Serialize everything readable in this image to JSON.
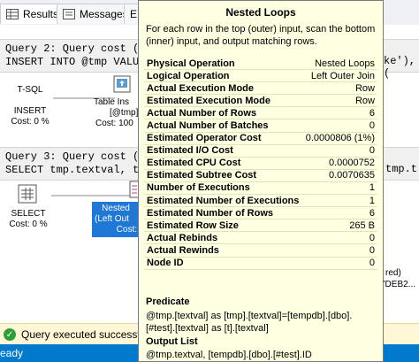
{
  "tabs": [
    {
      "label": "Results"
    },
    {
      "label": "Messages"
    },
    {
      "label": "E"
    }
  ],
  "query2": {
    "header": "Query 2: Query cost (",
    "sql": "INSERT INTO @tmp VALU",
    "sql_right": "ke'), ("
  },
  "query3": {
    "header": "Query 3: Query cost (",
    "sql": "SELECT tmp.textval, t",
    "sql_right": "tmp.t"
  },
  "nodes": {
    "tsql_label": "T-SQL",
    "insert_label": "INSERT",
    "insert_cost": "Cost: 0 %",
    "table_insert_label": "Table Ins",
    "table_insert_sub": "[@tmp]",
    "table_insert_cost": "Cost: 100",
    "select_label": "SELECT",
    "select_cost": "Cost: 0 %",
    "nested_label": "Nested",
    "nested_sub": "(Left Out",
    "nested_cost": "Cost:",
    "right_text1": "red)",
    "right_text2": "7DEB2..."
  },
  "tooltip": {
    "title": "Nested Loops",
    "description": "For each row in the top (outer) input, scan the bottom (inner) input, and output matching rows.",
    "properties": [
      {
        "key": "Physical Operation",
        "value": "Nested Loops"
      },
      {
        "key": "Logical Operation",
        "value": "Left Outer Join"
      },
      {
        "key": "Actual Execution Mode",
        "value": "Row"
      },
      {
        "key": "Estimated Execution Mode",
        "value": "Row"
      },
      {
        "key": "Actual Number of Rows",
        "value": "6"
      },
      {
        "key": "Actual Number of Batches",
        "value": "0"
      },
      {
        "key": "Estimated Operator Cost",
        "value": "0.0000806 (1%)"
      },
      {
        "key": "Estimated I/O Cost",
        "value": "0"
      },
      {
        "key": "Estimated CPU Cost",
        "value": "0.0000752"
      },
      {
        "key": "Estimated Subtree Cost",
        "value": "0.0070635"
      },
      {
        "key": "Number of Executions",
        "value": "1"
      },
      {
        "key": "Estimated Number of Executions",
        "value": "1"
      },
      {
        "key": "Estimated Number of Rows",
        "value": "6"
      },
      {
        "key": "Estimated Row Size",
        "value": "265 B"
      },
      {
        "key": "Actual Rebinds",
        "value": "0"
      },
      {
        "key": "Actual Rewinds",
        "value": "0"
      },
      {
        "key": "Node ID",
        "value": "0"
      }
    ],
    "predicate_label": "Predicate",
    "predicate_text": "@tmp.[textval] as [tmp].[textval]=[tempdb].[dbo].[#test].[textval] as [t].[textval]",
    "output_label": "Output List",
    "output_text": "@tmp.textval, [tempdb].[dbo].[#test].ID"
  },
  "status": {
    "message": "Query executed successfully.",
    "bar_text": "eady"
  },
  "colors": {
    "tooltip_bg": "#ffffe1",
    "status_blue": "#007acc",
    "highlight_blue": "#1f77d6",
    "ok_green": "#2e9e3a"
  }
}
